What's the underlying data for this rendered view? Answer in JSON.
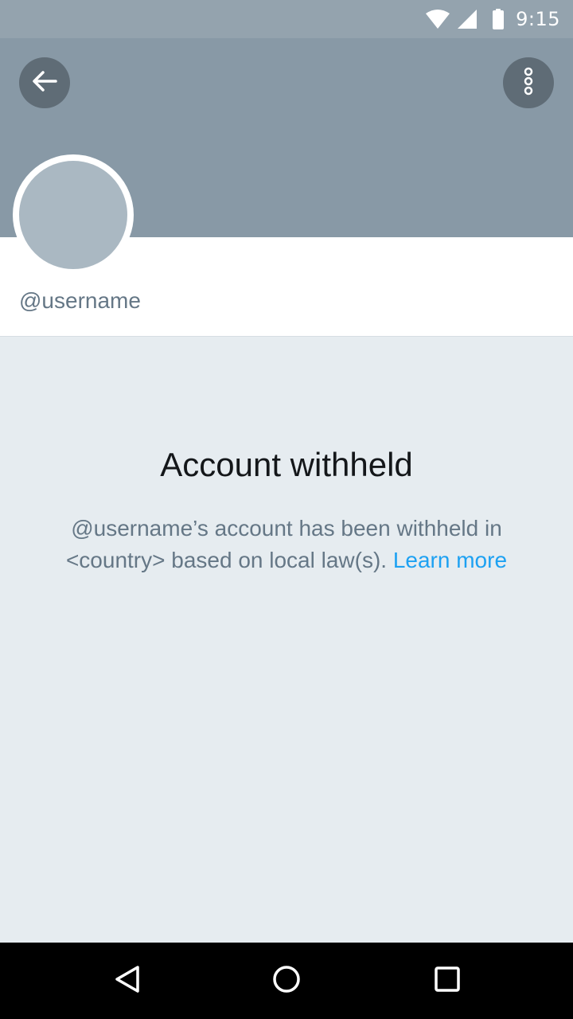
{
  "status_bar": {
    "time": "9:15",
    "icons": [
      "wifi-icon",
      "signal-icon",
      "battery-icon"
    ]
  },
  "header": {
    "back_icon": "arrow-left-icon",
    "menu_icon": "more-vertical-icon"
  },
  "profile": {
    "username": "@username"
  },
  "notice": {
    "title": "Account withheld",
    "message_line1": "@username’s account has been withheld in",
    "message_line2": "<country> based on local law(s).",
    "link_label": "Learn more"
  },
  "nav_bar": {
    "icons": [
      "nav-back-icon",
      "nav-home-icon",
      "nav-recents-icon"
    ]
  },
  "colors": {
    "header_bg": "#8899a6",
    "status_bg": "#94a3ae",
    "avatar_bg": "#aab8c2",
    "body_bg": "#e6ecf0",
    "link": "#1da1f2",
    "secondary_text": "#657786",
    "primary_text": "#14171a"
  }
}
